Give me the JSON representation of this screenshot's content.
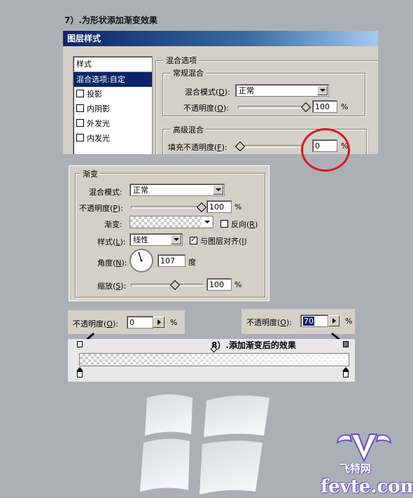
{
  "step7_title": "7）.为形状添加渐变效果",
  "dialog1": {
    "title": "图层样式",
    "list_header": "样式",
    "list_items": [
      "混合选项:自定",
      "投影",
      "内阴影",
      "外发光",
      "内发光"
    ],
    "blend_options_label": "混合选项",
    "general_blend_label": "常规混合",
    "blend_mode_label": "混合模式(",
    "blend_mode_key": "D",
    "blend_mode_value": "正常",
    "opacity_label": "不透明度(",
    "opacity_key": "O",
    "opacity_value": "100",
    "percent": "%",
    "advanced_blend_label": "高级混合",
    "fill_opacity_label": "填充不透明度(",
    "fill_opacity_key": "F",
    "fill_opacity_value": "0"
  },
  "dialog2": {
    "group_label": "渐变",
    "blend_mode_label": "混合模式:",
    "blend_mode_value": "正常",
    "opacity_label": "不透明度(",
    "opacity_key": "P",
    "opacity_value": "100",
    "gradient_label": "渐变:",
    "reverse_label": "反向(",
    "reverse_key": "R",
    "style_label": "样式(",
    "style_key": "L",
    "style_value": "线性",
    "align_label": "与图层对齐(",
    "align_key": "I",
    "angle_label": "角度(",
    "angle_key": "N",
    "angle_value": "107",
    "degree": "度",
    "scale_label": "缩放(",
    "scale_key": "S",
    "scale_value": "100",
    "percent": "%"
  },
  "gradient_editor": {
    "left_opacity_label": "不透明度(",
    "left_opacity_key": "O",
    "left_opacity_value": "0",
    "right_opacity_label": "不透明度(",
    "right_opacity_key": "O",
    "right_opacity_value": "70",
    "percent": "%"
  },
  "step8_title": "8）.添加渐变后的效果",
  "watermark": {
    "brand_cn": "飞特网",
    "brand_url": "fevte.com"
  },
  "colors": {
    "background": "#abb0b7",
    "selection": "#0a246a",
    "highlight_circle": "#e0181c"
  }
}
